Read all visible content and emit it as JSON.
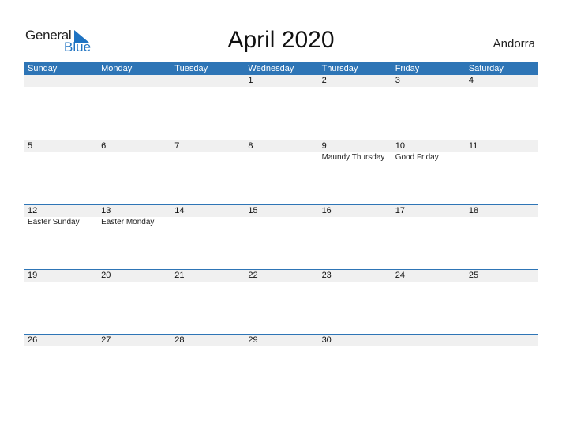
{
  "logo": {
    "general": "General",
    "blue": "Blue"
  },
  "title": "April 2020",
  "country": "Andorra",
  "colors": {
    "header": "#2e75b6",
    "logo_blue": "#1f73c2",
    "day_row": "#f0f0f0"
  },
  "weekdays": [
    "Sunday",
    "Monday",
    "Tuesday",
    "Wednesday",
    "Thursday",
    "Friday",
    "Saturday"
  ],
  "weeks": [
    {
      "days": [
        "",
        "",
        "",
        "1",
        "2",
        "3",
        "4"
      ],
      "events": [
        "",
        "",
        "",
        "",
        "",
        "",
        ""
      ]
    },
    {
      "days": [
        "5",
        "6",
        "7",
        "8",
        "9",
        "10",
        "11"
      ],
      "events": [
        "",
        "",
        "",
        "",
        "Maundy Thursday",
        "Good Friday",
        ""
      ]
    },
    {
      "days": [
        "12",
        "13",
        "14",
        "15",
        "16",
        "17",
        "18"
      ],
      "events": [
        "Easter Sunday",
        "Easter Monday",
        "",
        "",
        "",
        "",
        ""
      ]
    },
    {
      "days": [
        "19",
        "20",
        "21",
        "22",
        "23",
        "24",
        "25"
      ],
      "events": [
        "",
        "",
        "",
        "",
        "",
        "",
        ""
      ]
    },
    {
      "days": [
        "26",
        "27",
        "28",
        "29",
        "30",
        "",
        ""
      ],
      "events": [
        "",
        "",
        "",
        "",
        "",
        "",
        ""
      ]
    }
  ]
}
